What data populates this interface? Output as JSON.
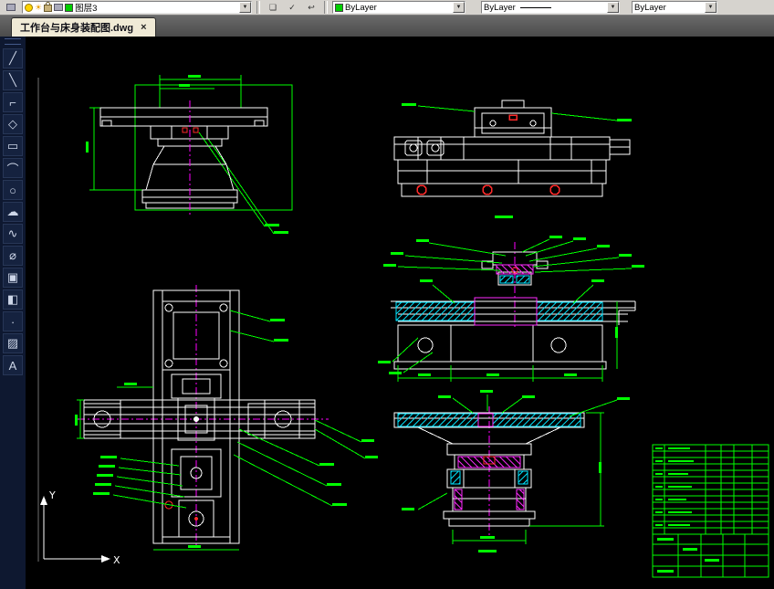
{
  "toolbar": {
    "layers_button": {
      "icon": "layers-icon"
    },
    "layer_combo": {
      "value": "图层3",
      "status_icons": [
        "lightbulb-icon",
        "sun-icon",
        "lock-icon",
        "printer-icon",
        "layer-color-swatch"
      ],
      "swatch_color": "#00d000",
      "arrow": "▼"
    },
    "layer_buttons": [
      {
        "name": "layer-states-button",
        "glyph": "❏"
      },
      {
        "name": "make-current-button",
        "glyph": "✓"
      },
      {
        "name": "layer-previous-button",
        "glyph": "↩"
      }
    ],
    "color_combo": {
      "value": "ByLayer",
      "swatch_color": "#00d000",
      "arrow": "▼"
    },
    "linetype_combo": {
      "value": "ByLayer",
      "arrow": "▼"
    },
    "lineweight_combo": {
      "value": "ByLayer",
      "arrow": "▼"
    }
  },
  "tabbar": {
    "tabs": [
      {
        "label": "工作台与床身装配图.dwg",
        "close": "×",
        "active": true
      }
    ]
  },
  "draw_toolbar": {
    "tools": [
      {
        "name": "line",
        "glyph": "╱"
      },
      {
        "name": "construction-line",
        "glyph": "╲"
      },
      {
        "name": "polyline",
        "glyph": "⌐"
      },
      {
        "name": "polygon",
        "glyph": "◇"
      },
      {
        "name": "rectangle",
        "glyph": "▭"
      },
      {
        "name": "arc",
        "glyph": "⌒"
      },
      {
        "name": "circle",
        "glyph": "○"
      },
      {
        "name": "revision-cloud",
        "glyph": "☁"
      },
      {
        "name": "spline",
        "glyph": "∿"
      },
      {
        "name": "ellipse",
        "glyph": "⌀"
      },
      {
        "name": "insert-block",
        "glyph": "▣"
      },
      {
        "name": "make-block",
        "glyph": "◧"
      },
      {
        "name": "point",
        "glyph": "∙"
      },
      {
        "name": "hatch",
        "glyph": "▨"
      },
      {
        "name": "text",
        "glyph": "A"
      }
    ]
  },
  "canvas": {
    "ucs": {
      "x_label": "X",
      "y_label": "Y"
    }
  },
  "colors": {
    "canvas_bg": "#000000",
    "geometry": "#ffffff",
    "dimensions": "#00ff00",
    "hatch_cyan": "#00e5ff",
    "hatch_magenta": "#ff00ff",
    "detail_red": "#ff2a2a",
    "toolbar_bg": "#d6d3ce",
    "tab_bg": "#f0ead6",
    "sidebar_bg": "#0e1830"
  }
}
